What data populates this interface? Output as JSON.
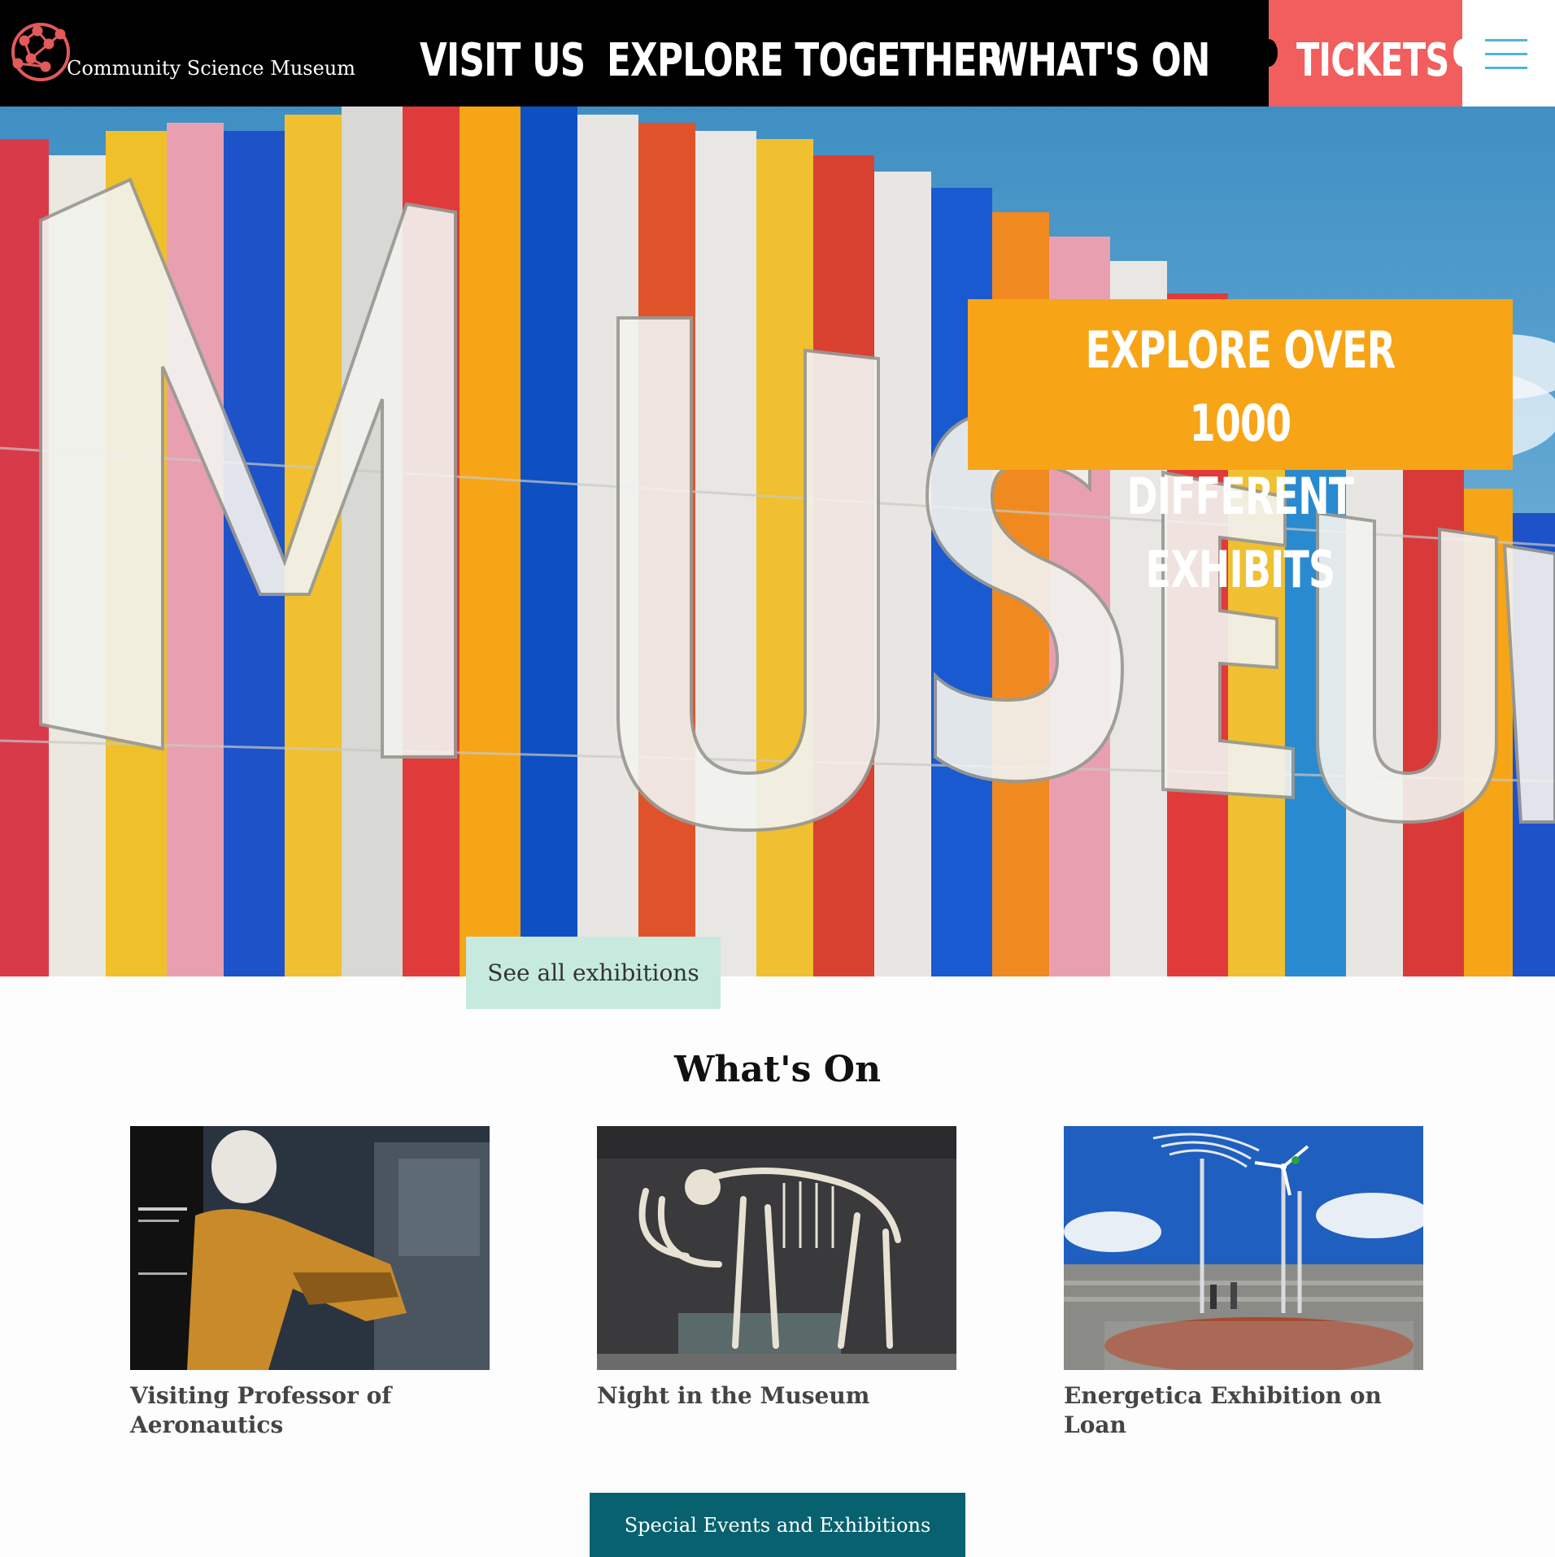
{
  "header": {
    "logo_text": "Community Science Museum",
    "nav": [
      "VISIT US",
      "EXPLORE TOGETHER",
      "WHAT'S ON"
    ],
    "tickets_label": "TICKETS",
    "menu_icon": "hamburger-menu-icon"
  },
  "hero": {
    "banner_line1": "EXPLORE OVER 1000",
    "banner_line2": "DIFFERENT EXHIBITS",
    "see_all_label": "See all exhibitions"
  },
  "whats_on": {
    "title": "What's On",
    "cards": [
      {
        "title": "Visiting Professor of Aeronautics"
      },
      {
        "title": "Night in the Museum"
      },
      {
        "title": "Energetica Exhibition on Loan"
      }
    ],
    "cta_label": "Special Events and Exhibitions"
  },
  "colors": {
    "header_bg": "#000000",
    "tickets_bg": "#f25e5e",
    "menu_icon": "#4fb5d6",
    "banner_bg": "#f7a516",
    "see_all_bg": "#c6eade",
    "cta_bg": "#07616e"
  }
}
